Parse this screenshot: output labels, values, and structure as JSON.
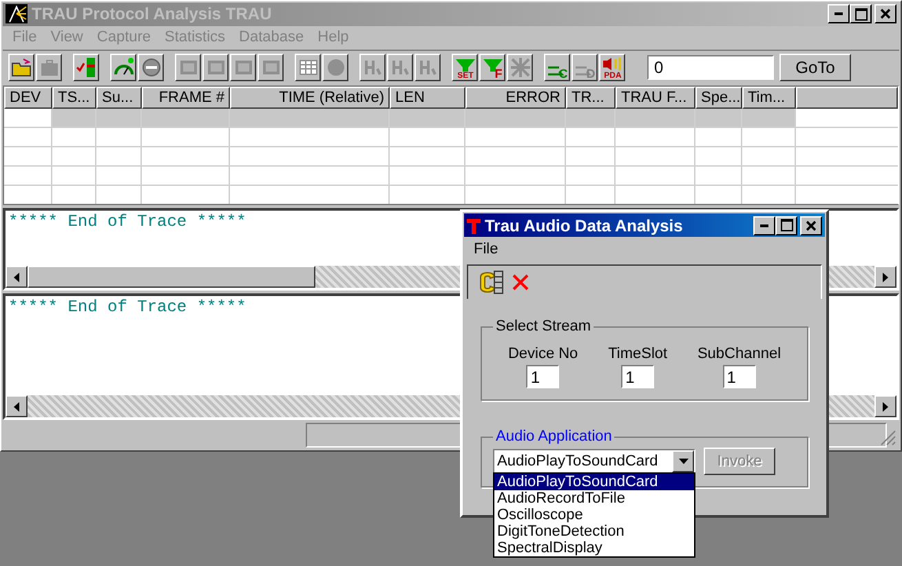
{
  "main_window": {
    "title": "TRAU Protocol Analysis TRAU",
    "menu": [
      "File",
      "View",
      "Capture",
      "Statistics",
      "Database",
      "Help"
    ],
    "toolbar": [
      [
        {
          "kind": "folder",
          "disabled": false
        },
        {
          "kind": "case",
          "disabled": true
        }
      ],
      [
        {
          "kind": "checklist",
          "disabled": false
        }
      ],
      [
        {
          "kind": "gauge",
          "disabled": false
        },
        {
          "kind": "stop",
          "disabled": true
        }
      ],
      [
        {
          "kind": "window",
          "disabled": true
        },
        {
          "kind": "window",
          "disabled": true
        },
        {
          "kind": "window",
          "disabled": true
        },
        {
          "kind": "window",
          "disabled": true
        }
      ],
      [
        {
          "kind": "grid",
          "disabled": true
        },
        {
          "kind": "disc",
          "disabled": true
        }
      ],
      [
        {
          "kind": "letter",
          "disabled": true
        },
        {
          "kind": "letter",
          "disabled": true
        },
        {
          "kind": "letter",
          "disabled": true
        }
      ],
      [
        {
          "kind": "funnel",
          "disabled": false,
          "caption": "SET"
        },
        {
          "kind": "funnel",
          "disabled": false,
          "caption": "F"
        },
        {
          "kind": "burst",
          "disabled": true
        }
      ],
      [
        {
          "kind": "arrows",
          "disabled": false,
          "caption": "C"
        },
        {
          "kind": "arrows",
          "disabled": true,
          "caption": "D"
        },
        {
          "kind": "speaker",
          "disabled": false,
          "caption": "PDA"
        }
      ]
    ],
    "goto": {
      "value": "0",
      "button": "GoTo"
    },
    "table": {
      "columns": [
        "DEV",
        "TS...",
        "Su...",
        "FRAME #",
        "TIME (Relative)",
        "LEN",
        "ERROR",
        "TR...",
        "TRAU F...",
        "Spe...",
        "Tim..."
      ],
      "rows": [
        {
          "selected": true
        },
        {
          "selected": false
        },
        {
          "selected": false
        },
        {
          "selected": false
        },
        {
          "selected": false
        }
      ]
    },
    "trace_panes": [
      {
        "text": "***** End of Trace *****"
      },
      {
        "text": "***** End of Trace *****"
      }
    ]
  },
  "dialog": {
    "title": "Trau Audio Data Analysis",
    "menu": [
      "File"
    ],
    "select_stream": {
      "legend": "Select Stream",
      "fields": [
        {
          "label": "Device No",
          "value": "1"
        },
        {
          "label": "TimeSlot",
          "value": "1"
        },
        {
          "label": "SubChannel",
          "value": "1"
        }
      ]
    },
    "audio_application": {
      "legend": "Audio Application",
      "combo_value": "AudioPlayToSoundCard",
      "button": {
        "label": "Invoke",
        "disabled": true
      },
      "options": [
        {
          "label": "AudioPlayToSoundCard",
          "selected": true
        },
        {
          "label": "AudioRecordToFile",
          "selected": false
        },
        {
          "label": "Oscilloscope",
          "selected": false
        },
        {
          "label": "DigitToneDetection",
          "selected": false
        },
        {
          "label": "SpectralDisplay",
          "selected": false
        }
      ]
    }
  }
}
